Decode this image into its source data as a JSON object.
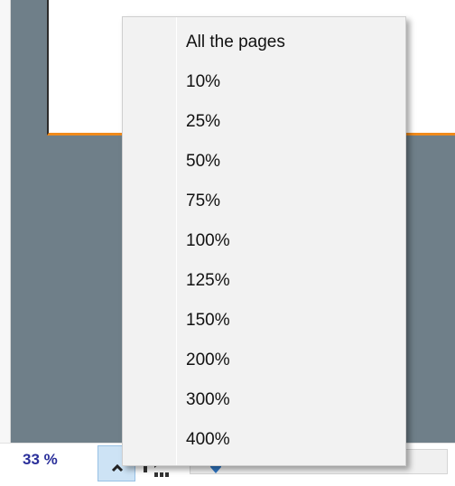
{
  "statusbar": {
    "zoom_value": "33 %"
  },
  "icons": {
    "zoom_up": "chevron-up-icon",
    "fit": "fit-page-icon",
    "slider_thumb": "slider-thumb-icon"
  },
  "zoom_menu": {
    "items": [
      {
        "label": "All the pages"
      },
      {
        "label": "10%"
      },
      {
        "label": "25%"
      },
      {
        "label": "50%"
      },
      {
        "label": "75%"
      },
      {
        "label": "100%"
      },
      {
        "label": "125%"
      },
      {
        "label": "150%"
      },
      {
        "label": "200%"
      },
      {
        "label": "300%"
      },
      {
        "label": "400%"
      }
    ]
  },
  "colors": {
    "preview_background": "#6f7f89",
    "page_border_accent": "#f08a1c",
    "zoom_text": "#2a2f9a",
    "selected_button": "#cde3f5",
    "slider_thumb": "#2f77c4"
  }
}
